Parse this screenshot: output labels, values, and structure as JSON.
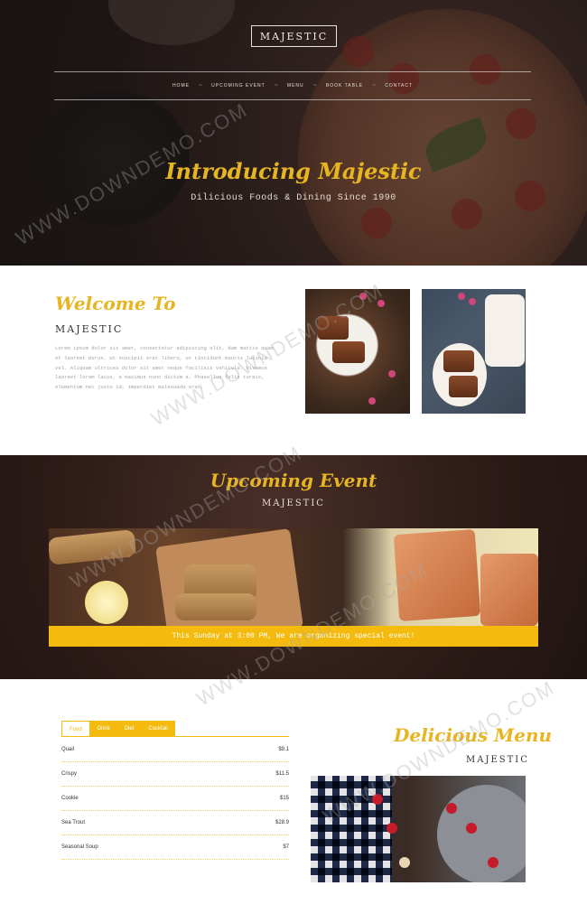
{
  "header": {
    "logo": "MAJESTIC",
    "nav": [
      {
        "label": "HOME"
      },
      {
        "label": "UPCOMING EVENT"
      },
      {
        "label": "MENU"
      },
      {
        "label": "BOOK TABLE"
      },
      {
        "label": "CONTACT"
      }
    ],
    "nav_separator": "~",
    "hero_title": "Introducing Majestic",
    "hero_subtitle": "Dilicious Foods & Dining Since 1990"
  },
  "welcome": {
    "title": "Welcome To",
    "subtitle": "MAJESTIC",
    "text": "Lorem ipsum dolor sit amet, consectetur adipiscing elit. Nam mattis quam et laoreet purus. Ut suscipit erat libero, ut tincidunt mauris lacinia vel. Aliquam ultrices dolor sit amet neque facilisis vehicula. Vivamus laoreet lorem lacus, a maximus nunc dictum a. Phasellus felis turpis, elementum nec justo id, imperdiet malesuada erat."
  },
  "event": {
    "title": "Upcoming Event",
    "subtitle": "MAJESTIC",
    "banner": "This Sunday at 3:00 PM, We are organizing special event!"
  },
  "menu": {
    "tabs": [
      {
        "label": "Food",
        "active": true
      },
      {
        "label": "Drink",
        "active": false
      },
      {
        "label": "Diet",
        "active": false
      },
      {
        "label": "Cocktail",
        "active": false
      }
    ],
    "items": [
      {
        "name": "Quail",
        "price": "$9.1"
      },
      {
        "name": "Crispy",
        "price": "$11.5"
      },
      {
        "name": "Cookie",
        "price": "$15"
      },
      {
        "name": "Sea Trout",
        "price": "$28.9"
      },
      {
        "name": "Seasonal Soup",
        "price": "$7"
      }
    ],
    "title": "Delicious Menu",
    "subtitle": "MAJESTIC"
  },
  "watermark": "WWW.DOWNDEMO.COM",
  "colors": {
    "accent": "#e7b521",
    "banner": "#f4bb0e",
    "dark": "#2a1c19"
  }
}
